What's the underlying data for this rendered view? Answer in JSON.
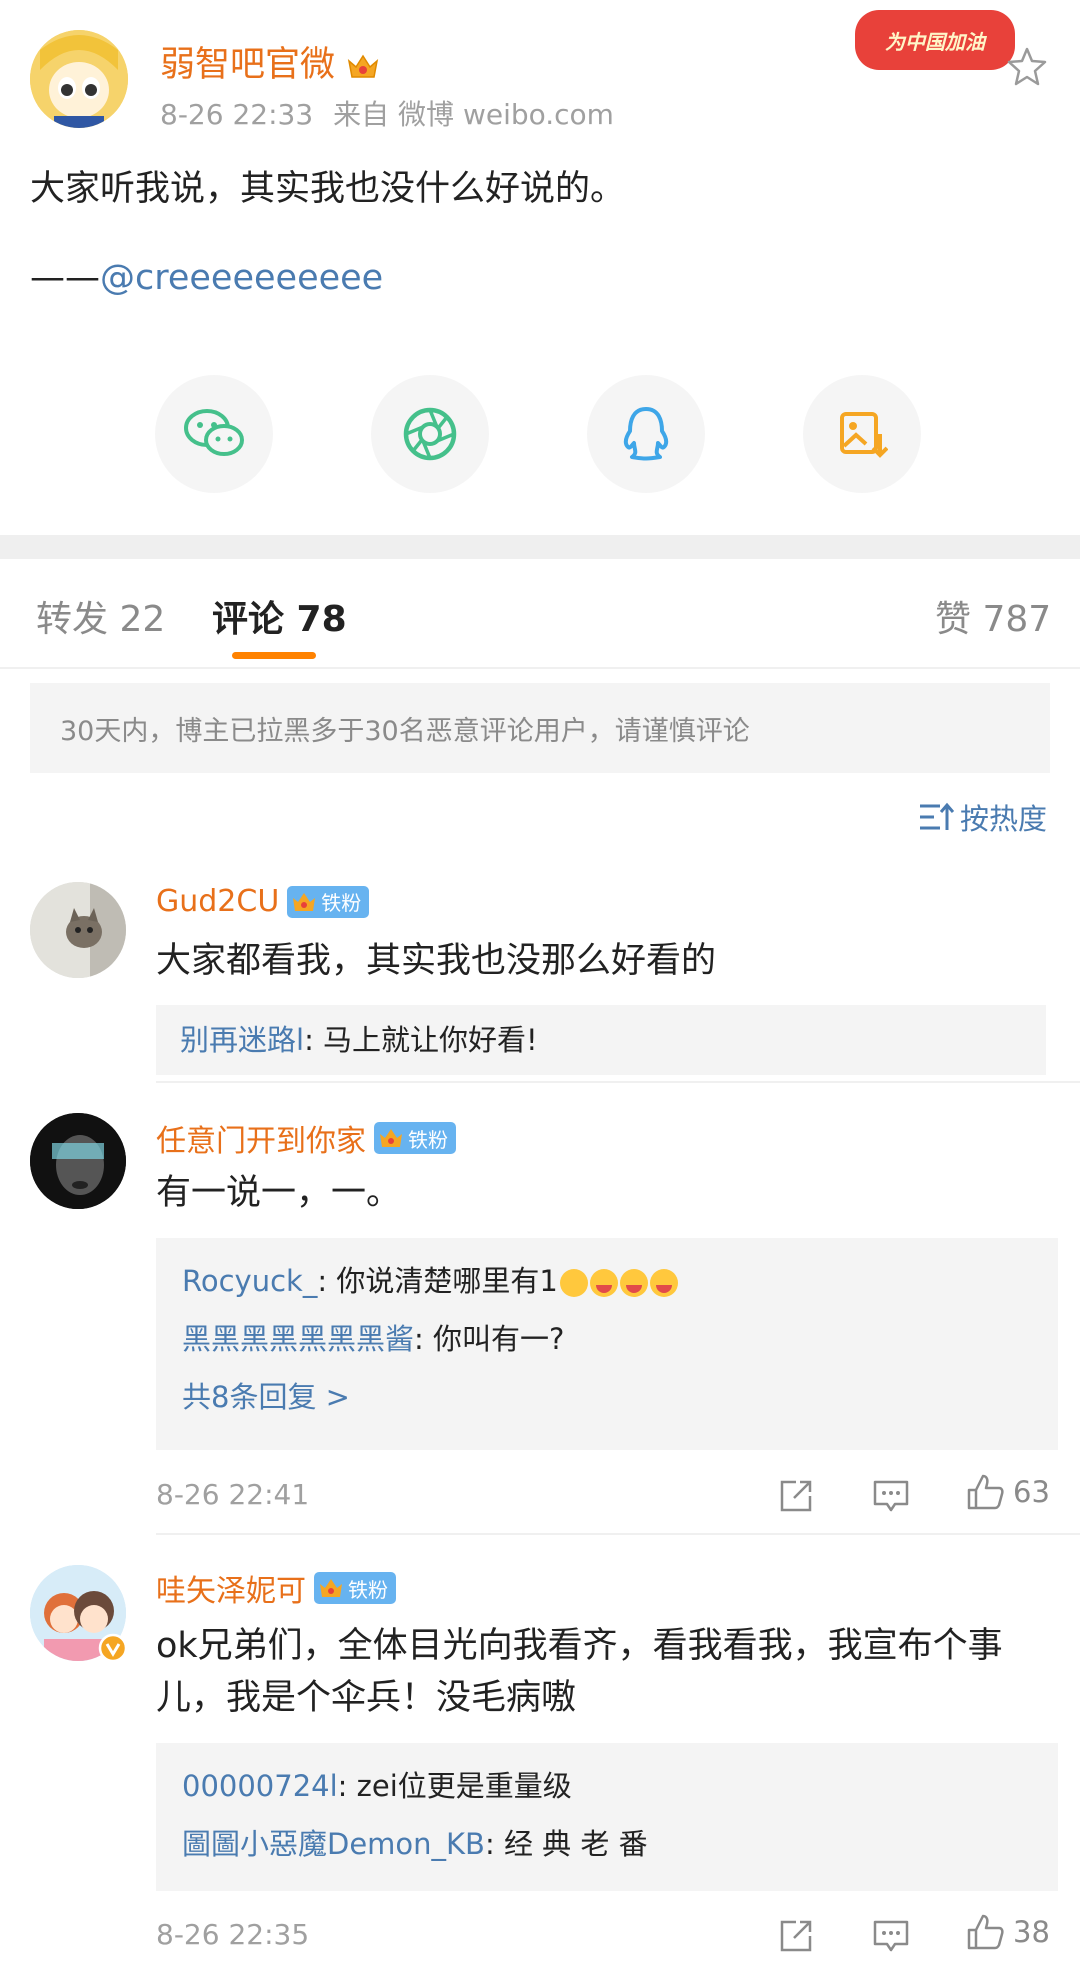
{
  "post": {
    "author": "弱智吧官微",
    "time": "8-26 22:33",
    "source": "来自 微博 weibo.com",
    "promo": "为中国加油",
    "text": "大家听我说，其实我也没什么好说的。",
    "credit_prefix": "——",
    "credit_mention": "@creeeeeeeeee"
  },
  "share": {
    "wechat_icon": "wechat-icon",
    "moments_icon": "moments-icon",
    "qq_icon": "qq-icon",
    "save_image_icon": "save-image-icon"
  },
  "tabs": {
    "repost": "转发 22",
    "comments": "评论 78",
    "likes": "赞 787"
  },
  "notice": "30天内，博主已拉黑多于30名恶意评论用户，请谨慎评论",
  "sort_label": "按热度",
  "fan_badge": "铁粉",
  "comments": [
    {
      "name": "Gud2CU",
      "text": "大家都看我，其实我也没那么好看的",
      "replies": [
        {
          "user": "别再迷路l",
          "text": ": 马上就让你好看!"
        }
      ]
    },
    {
      "name": "任意门开到你家",
      "text": "有一说一，一。",
      "replies": [
        {
          "user": "Rocyuck_",
          "text": ": 你说清楚哪里有1"
        },
        {
          "user": "黑黑黑黑黑黑黑酱",
          "text": ": 你叫有一?"
        }
      ],
      "more": "共8条回复 >",
      "time": "8-26 22:41",
      "likes": "63"
    },
    {
      "name": "哇矢泽妮可",
      "text": "ok兄弟们，全体目光向我看齐，看我看我，我宣布个事儿，我是个伞兵！没毛病嗷",
      "replies": [
        {
          "user": "00000724l",
          "text": ": zei位更是重量级"
        },
        {
          "user": "圖圖小惡魔Demon_KB",
          "text": ": 经 典 老 番"
        }
      ],
      "time": "8-26 22:35",
      "likes": "38"
    }
  ],
  "colors": {
    "name_orange": "#e8701a",
    "link_blue": "#4a7bb0",
    "tab_underline": "#ff8200",
    "fan_badge_blue": "#67b3f0"
  }
}
